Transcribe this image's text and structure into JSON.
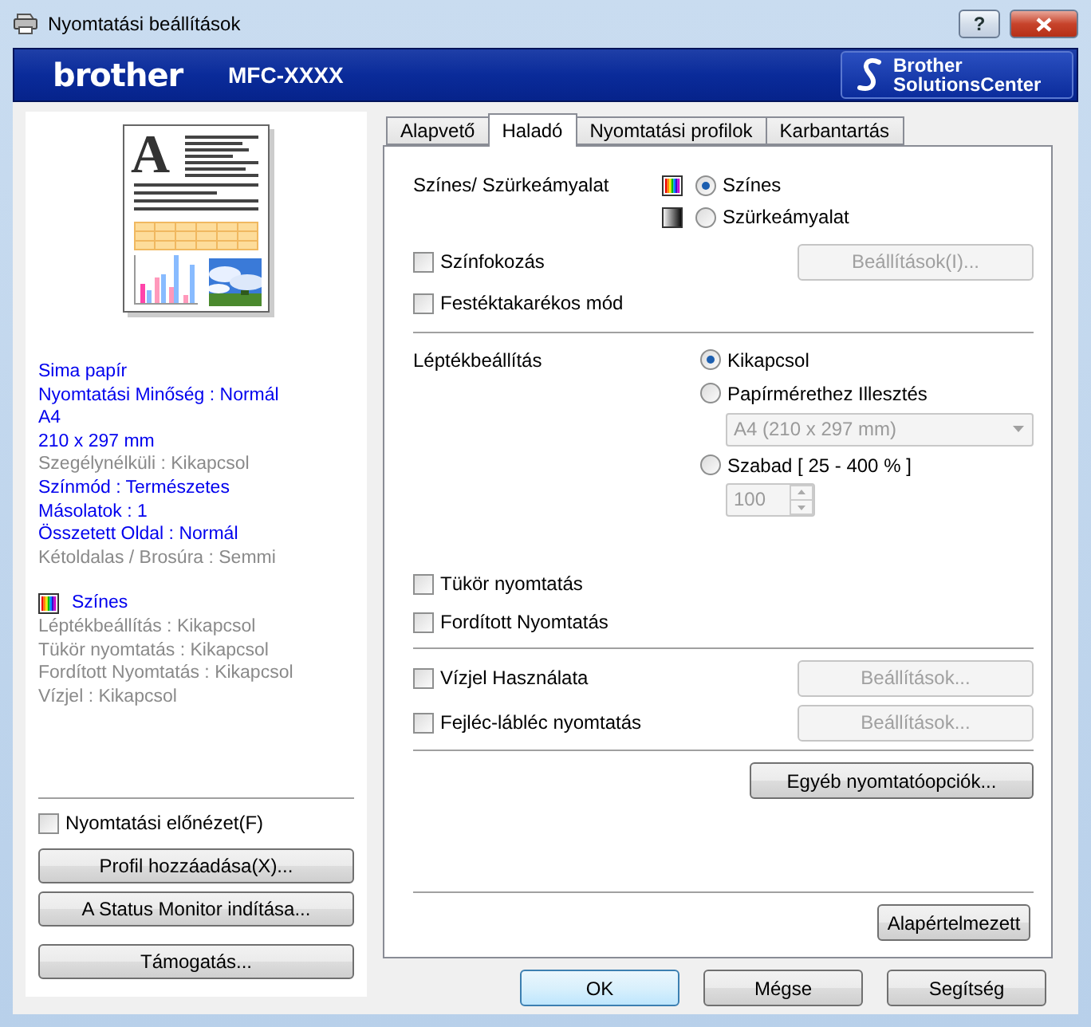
{
  "window": {
    "title": "Nyomtatási beállítások",
    "help": "?"
  },
  "header": {
    "brand": "brother",
    "model": "MFC-XXXX",
    "solutions_center": [
      "Brother",
      "SolutionsCenter"
    ]
  },
  "preview": {
    "letter": "A"
  },
  "summary": [
    {
      "text": "Sima papír",
      "dimmed": false
    },
    {
      "text": "Nyomtatási Minőség : Normál",
      "dimmed": false
    },
    {
      "text": "A4",
      "dimmed": false
    },
    {
      "text": "210 x 297 mm",
      "dimmed": false
    },
    {
      "text": "Szegélynélküli : Kikapcsol",
      "dimmed": true
    },
    {
      "text": "Színmód : Természetes",
      "dimmed": false
    },
    {
      "text": "Másolatok : 1",
      "dimmed": false
    },
    {
      "text": "Összetett Oldal : Normál",
      "dimmed": false
    },
    {
      "text": "Kétoldalas / Brosúra : Semmi",
      "dimmed": true
    }
  ],
  "summary_color": {
    "kind": "color",
    "text": "Színes"
  },
  "summary_2": [
    {
      "text": "Léptékbeállítás : Kikapcsol",
      "dimmed": true
    },
    {
      "text": "Tükör nyomtatás : Kikapcsol",
      "dimmed": true
    },
    {
      "text": "Fordított Nyomtatás : Kikapcsol",
      "dimmed": true
    },
    {
      "text": "Vízjel : Kikapcsol",
      "dimmed": true
    }
  ],
  "preview_checkbox": {
    "label": "Nyomtatási előnézet(F)",
    "checked": false
  },
  "side_buttons": [
    "Profil hozzáadása(X)...",
    "A Status Monitor indítása...",
    "Támogatás..."
  ],
  "tabs": [
    {
      "label": "Alapvető",
      "selected": false
    },
    {
      "label": "Haladó",
      "selected": true
    },
    {
      "label": "Nyomtatási profilok",
      "selected": false
    },
    {
      "label": "Karbantartás",
      "selected": false
    }
  ],
  "color_section": {
    "label": "Színes/ Szürkeámyalat",
    "options": [
      {
        "kind": "color",
        "label": "Színes",
        "selected": true
      },
      {
        "kind": "gray",
        "label": "Szürkeámyalat",
        "selected": false
      }
    ]
  },
  "options_1": [
    {
      "label": "Színfokozás",
      "checked": false,
      "button": {
        "label": "Beállítások(I)...",
        "disabled": true
      }
    },
    {
      "label": "Festéktakarékos mód",
      "checked": false
    }
  ],
  "scaling": {
    "label": "Léptékbeállítás",
    "options": [
      {
        "kind": "plain",
        "label": "Kikapcsol",
        "selected": true
      },
      {
        "kind": "dropdown",
        "label": "Papírmérethez Illesztés",
        "selected": false,
        "value": "A4 (210 x 297 mm)",
        "disabled": true
      },
      {
        "kind": "spinner",
        "label": "Szabad [ 25 - 400 % ]",
        "selected": false,
        "value": "100",
        "disabled": true
      }
    ]
  },
  "options_2": [
    {
      "label": "Tükör nyomtatás",
      "checked": false
    },
    {
      "label": "Fordított Nyomtatás",
      "checked": false
    }
  ],
  "options_3": [
    {
      "label": "Vízjel Használata",
      "checked": false,
      "button": {
        "label": "Beállítások...",
        "disabled": true
      }
    },
    {
      "label": "Fejléc-lábléc nyomtatás",
      "checked": false,
      "button": {
        "label": "Beállítások...",
        "disabled": true
      }
    }
  ],
  "other_options_button": "Egyéb nyomtatóopciók...",
  "default_button": "Alapértelmezett",
  "dialog_buttons": [
    {
      "label": "OK",
      "default": true
    },
    {
      "label": "Mégse",
      "default": false
    },
    {
      "label": "Segítség",
      "default": false
    }
  ]
}
